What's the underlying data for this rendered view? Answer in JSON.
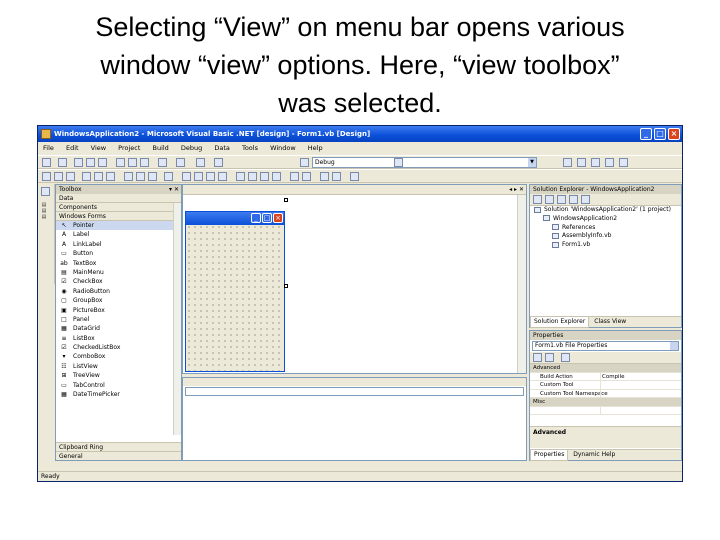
{
  "caption": {
    "line1": "Selecting “View” on menu bar opens various",
    "line2": "window “view” options. Here, “view toolbox”",
    "line3": "was selected."
  },
  "window": {
    "title": "WindowsApplication2 - Microsoft Visual Basic .NET [design] - Form1.vb [Design]"
  },
  "menu": [
    "File",
    "Edit",
    "View",
    "Project",
    "Build",
    "Debug",
    "Data",
    "Tools",
    "Window",
    "Help"
  ],
  "toolbar": {
    "config_value": "Debug"
  },
  "toolbox": {
    "title": "Toolbox",
    "categories": [
      "Data",
      "Components",
      "Windows Forms"
    ],
    "items": [
      {
        "label": "Pointer",
        "icon": "pointer-icon",
        "glyph": "↖"
      },
      {
        "label": "Label",
        "icon": "label-icon",
        "glyph": "A"
      },
      {
        "label": "LinkLabel",
        "icon": "linklabel-icon",
        "glyph": "A"
      },
      {
        "label": "Button",
        "icon": "button-icon",
        "glyph": "▭"
      },
      {
        "label": "TextBox",
        "icon": "textbox-icon",
        "glyph": "ab"
      },
      {
        "label": "MainMenu",
        "icon": "mainmenu-icon",
        "glyph": "▤"
      },
      {
        "label": "CheckBox",
        "icon": "checkbox-icon",
        "glyph": "☑"
      },
      {
        "label": "RadioButton",
        "icon": "radiobutton-icon",
        "glyph": "◉"
      },
      {
        "label": "GroupBox",
        "icon": "groupbox-icon",
        "glyph": "▢"
      },
      {
        "label": "PictureBox",
        "icon": "picturebox-icon",
        "glyph": "▣"
      },
      {
        "label": "Panel",
        "icon": "panel-icon",
        "glyph": "□"
      },
      {
        "label": "DataGrid",
        "icon": "datagrid-icon",
        "glyph": "▦"
      },
      {
        "label": "ListBox",
        "icon": "listbox-icon",
        "glyph": "≡"
      },
      {
        "label": "CheckedListBox",
        "icon": "checkedlistbox-icon",
        "glyph": "☑"
      },
      {
        "label": "ComboBox",
        "icon": "combobox-icon",
        "glyph": "▾"
      },
      {
        "label": "ListView",
        "icon": "listview-icon",
        "glyph": "☷"
      },
      {
        "label": "TreeView",
        "icon": "treeview-icon",
        "glyph": "⊞"
      },
      {
        "label": "TabControl",
        "icon": "tabcontrol-icon",
        "glyph": "▭"
      },
      {
        "label": "DateTimePicker",
        "icon": "datetimepicker-icon",
        "glyph": "▦"
      }
    ],
    "footer_categories": [
      "Clipboard Ring",
      "General"
    ]
  },
  "solution_explorer": {
    "title": "Solution Explorer - WindowsApplication2",
    "tree": [
      {
        "label": "Solution 'WindowsApplication2' (1 project)",
        "indent": 0
      },
      {
        "label": "WindowsApplication2",
        "indent": 1
      },
      {
        "label": "References",
        "indent": 2
      },
      {
        "label": "AssemblyInfo.vb",
        "indent": 2
      },
      {
        "label": "Form1.vb",
        "indent": 2
      }
    ],
    "tabs": [
      "Solution Explorer",
      "Class View"
    ]
  },
  "properties": {
    "title": "Properties",
    "object": "Form1.vb  File Properties",
    "rows": [
      {
        "type": "category",
        "name": "Advanced"
      },
      {
        "type": "prop",
        "name": "Build Action",
        "value": "Compile"
      },
      {
        "type": "prop",
        "name": "Custom Tool",
        "value": ""
      },
      {
        "type": "prop",
        "name": "Custom Tool Namespace",
        "value": ""
      },
      {
        "type": "category",
        "name": "Misc"
      },
      {
        "type": "prop",
        "name": "",
        "value": ""
      }
    ],
    "description_title": "Advanced",
    "tabs": [
      "Properties",
      "Dynamic Help"
    ]
  },
  "status": {
    "text": "Ready"
  }
}
